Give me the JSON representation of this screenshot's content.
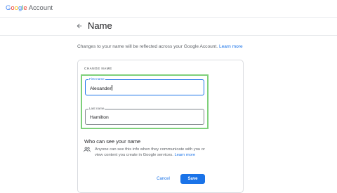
{
  "header": {
    "logo_letters": [
      {
        "char": "G",
        "color": "#4285F4"
      },
      {
        "char": "o",
        "color": "#EA4335"
      },
      {
        "char": "o",
        "color": "#FBBC05"
      },
      {
        "char": "g",
        "color": "#4285F4"
      },
      {
        "char": "l",
        "color": "#34A853"
      },
      {
        "char": "e",
        "color": "#EA4335"
      }
    ],
    "logo_suffix": "Account"
  },
  "page": {
    "back_icon": "arrow-back-icon",
    "title": "Name",
    "intro_text": "Changes to your name will be reflected across your Google Account.",
    "intro_link": "Learn more"
  },
  "card": {
    "section_label": "CHANGE NAME",
    "first_name": {
      "label": "First name",
      "value": "Alexander"
    },
    "last_name": {
      "label": "Last name",
      "value": "Hamilton"
    },
    "who_heading": "Who can see your name",
    "who_icon": "people-icon",
    "who_text": "Anyone can see this info when they communicate with you or view content you create in Google services.",
    "who_link": "Learn more",
    "cancel_label": "Cancel",
    "save_label": "Save"
  },
  "colors": {
    "accent": "#1a73e8",
    "highlight": "#7ed07a"
  }
}
